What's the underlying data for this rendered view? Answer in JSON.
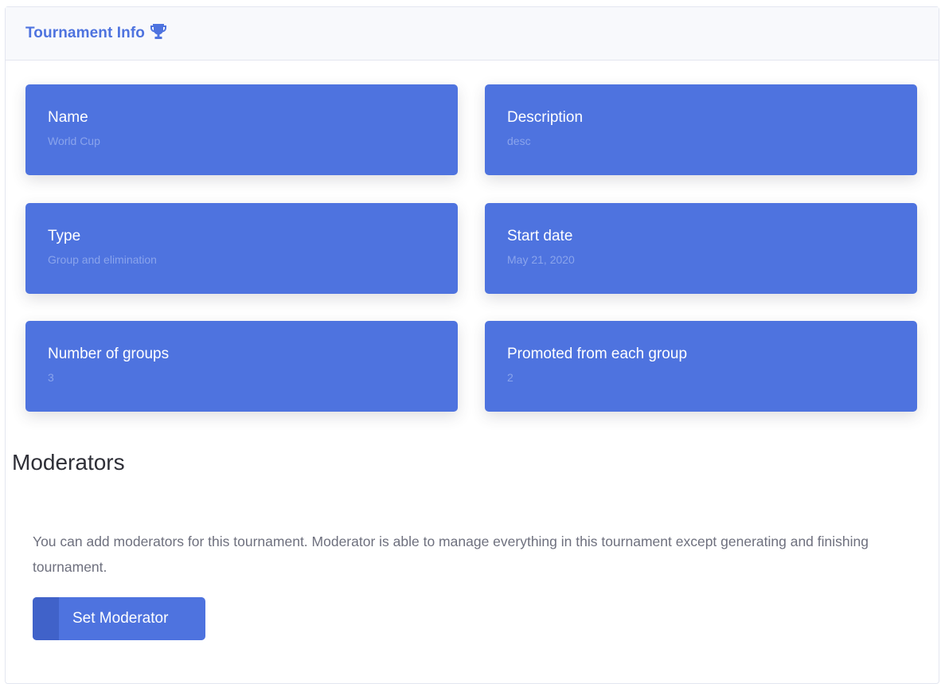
{
  "header": {
    "title": "Tournament Info",
    "icon": "trophy-icon"
  },
  "tiles": [
    {
      "label": "Name",
      "value": "World Cup"
    },
    {
      "label": "Description",
      "value": "desc"
    },
    {
      "label": "Type",
      "value": "Group and elimination"
    },
    {
      "label": "Start date",
      "value": "May 21, 2020"
    },
    {
      "label": "Number of groups",
      "value": "3"
    },
    {
      "label": "Promoted from each group",
      "value": "2"
    }
  ],
  "moderators": {
    "title": "Moderators",
    "description": "You can add moderators for this tournament. Moderator is able to manage everything in this tournament except generating and finishing tournament.",
    "button_label": "Set Moderator"
  },
  "colors": {
    "primary": "#4e73df",
    "header_bg": "#f8f9fc",
    "tile_value": "#8aa4ec"
  }
}
